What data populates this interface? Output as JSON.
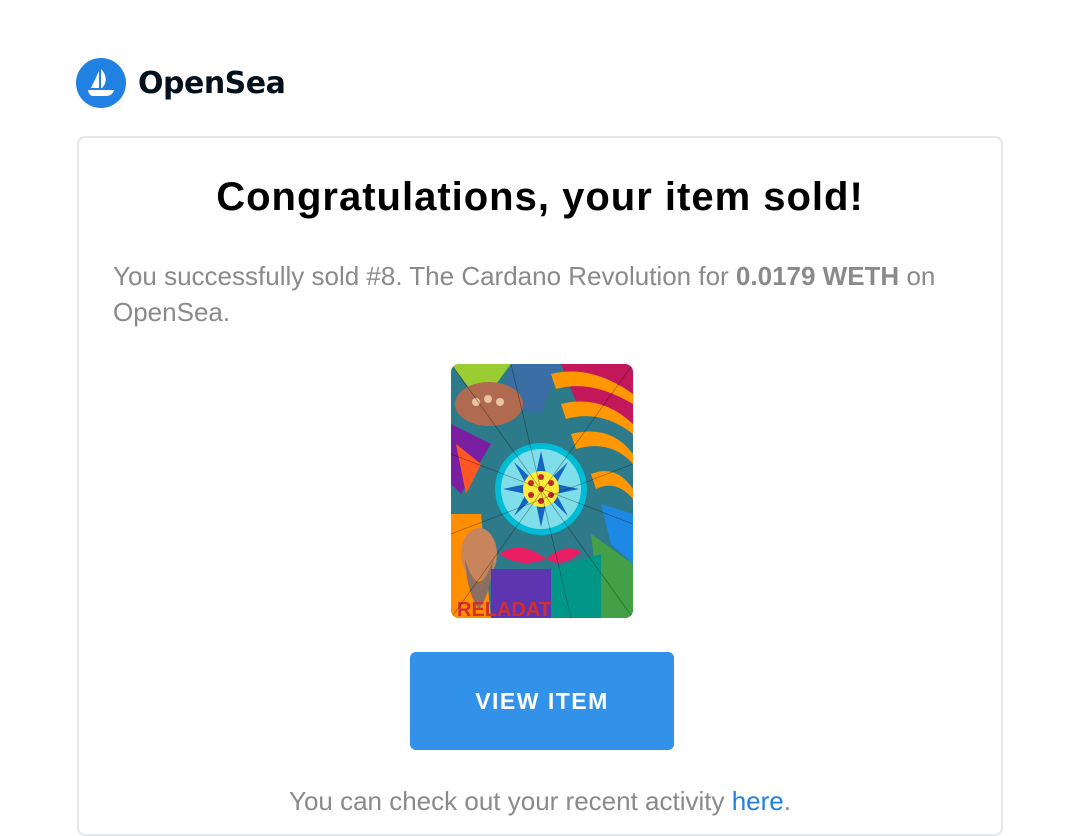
{
  "brand": {
    "name": "OpenSea",
    "logo_icon": "opensea-ship-icon",
    "color": "#2081e2"
  },
  "email": {
    "title": "Congratulations, your item sold!",
    "message_prefix": "You successfully sold #8. The Cardano Revolution for ",
    "price": "0.0179 WETH",
    "message_suffix": " on OpenSea.",
    "item_image_icon": "nft-artwork-image",
    "button_label": "VIEW ITEM",
    "button_color": "#3291e9",
    "footer_prefix": "You can check out your recent activity ",
    "footer_link": "here",
    "footer_suffix": "."
  }
}
